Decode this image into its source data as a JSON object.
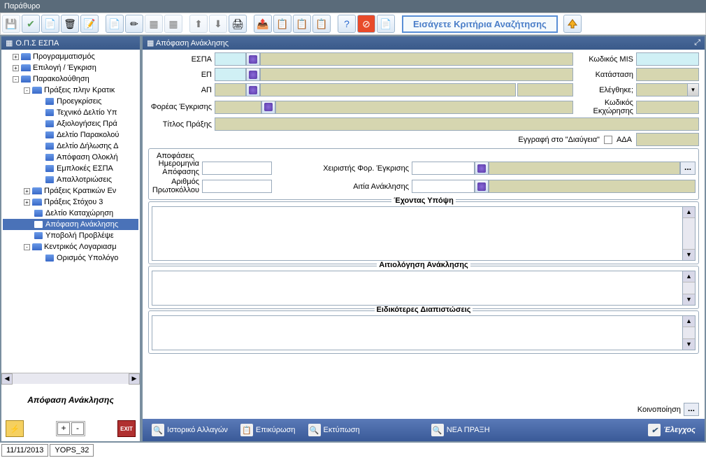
{
  "window": {
    "title": "Παράθυρο"
  },
  "toolbar": {
    "search_prompt": "Εισάγετε Κριτήρια Αναζήτησης"
  },
  "left": {
    "title": "Ο.Π.Σ ΕΣΠΑ",
    "caption": "Απόφαση Ανάκλησης",
    "nodes": [
      {
        "label": "Προγραμματισμός",
        "level": 1,
        "exp": "+",
        "icon": "folder"
      },
      {
        "label": "Επιλογή / Έγκριση",
        "level": 1,
        "exp": "+",
        "icon": "folder"
      },
      {
        "label": "Παρακολούθηση",
        "level": 1,
        "exp": "-",
        "icon": "folder"
      },
      {
        "label": "Πράξεις πλην Κρατικ",
        "level": 2,
        "exp": "-",
        "icon": "folder"
      },
      {
        "label": "Προεγκρίσεις",
        "level": 3,
        "icon": "page"
      },
      {
        "label": "Τεχνικό Δελτίο Υπ",
        "level": 3,
        "icon": "page"
      },
      {
        "label": "Αξιολογήσεις Πρά",
        "level": 3,
        "icon": "page"
      },
      {
        "label": "Δελτίο Παρακολού",
        "level": 3,
        "icon": "page"
      },
      {
        "label": "Δελτίο Δήλωσης Δ",
        "level": 3,
        "icon": "page"
      },
      {
        "label": "Απόφαση Ολοκλή",
        "level": 3,
        "icon": "page"
      },
      {
        "label": "Εμπλοκές ΕΣΠΑ",
        "level": 3,
        "icon": "page"
      },
      {
        "label": "Απαλλοτριώσεις",
        "level": 3,
        "icon": "page"
      },
      {
        "label": "Πράξεις Κρατικών Εν",
        "level": 2,
        "exp": "+",
        "icon": "folder"
      },
      {
        "label": "Πράξεις Στόχου 3",
        "level": 2,
        "exp": "+",
        "icon": "folder"
      },
      {
        "label": "Δελτίο Καταχώρηση",
        "level": 2,
        "icon": "page"
      },
      {
        "label": "Απόφαση Ανάκλησης",
        "level": 2,
        "icon": "page",
        "selected": true
      },
      {
        "label": "Υποβολή Προβλέψε",
        "level": 2,
        "icon": "page"
      },
      {
        "label": "Κεντρικός Λογαριασμ",
        "level": 2,
        "exp": "-",
        "icon": "folder"
      },
      {
        "label": "Ορισμός Υπολόγο",
        "level": 3,
        "icon": "page"
      }
    ]
  },
  "form": {
    "title": "Απόφαση Ανάκλησης",
    "labels": {
      "espa": "ΕΣΠΑ",
      "ep": "ΕΠ",
      "ap": "ΑΠ",
      "foreas": "Φορέας Έγκρισης",
      "titlos": "Τίτλος Πράξης",
      "mis": "Κωδικός MIS",
      "katastasi": "Κατάσταση",
      "elegxthike": "Ελέγθηκε;",
      "kodikos_ekx": "Κωδικός Εκχώρησης",
      "diavgeia": "Εγγραφή στο \"Διαύγεια\"",
      "ada": "ΑΔΑ"
    },
    "apofaseis": {
      "legend": "Αποφάσεις",
      "imerominia": "Ημερομηνία Απόφασης",
      "xeiristis": "Χειριστής Φορ. Έγκρισης",
      "protokollo": "Αριθμός Πρωτοκόλλου",
      "aitia": "Αιτία Ανάκλησης"
    },
    "sections": {
      "exontas": "Έχοντας Υπόψη",
      "aitiologisi": "Αιτιολόγηση Ανάκλησης",
      "eidikoteres": "Ειδικότερες Διαπιστώσεις"
    },
    "koinopoiisi": "Κοινοποίηση"
  },
  "actions": {
    "istoriko": "Ιστορικό Αλλαγών",
    "epikyrosi": "Επικύρωση",
    "ektyposi": "Εκτύπωση",
    "nea_praxi": "ΝΕΑ ΠΡΑΞΗ",
    "elegxos": "Έλεγχος"
  },
  "status": {
    "date": "11/11/2013",
    "user": "YOPS_32"
  }
}
